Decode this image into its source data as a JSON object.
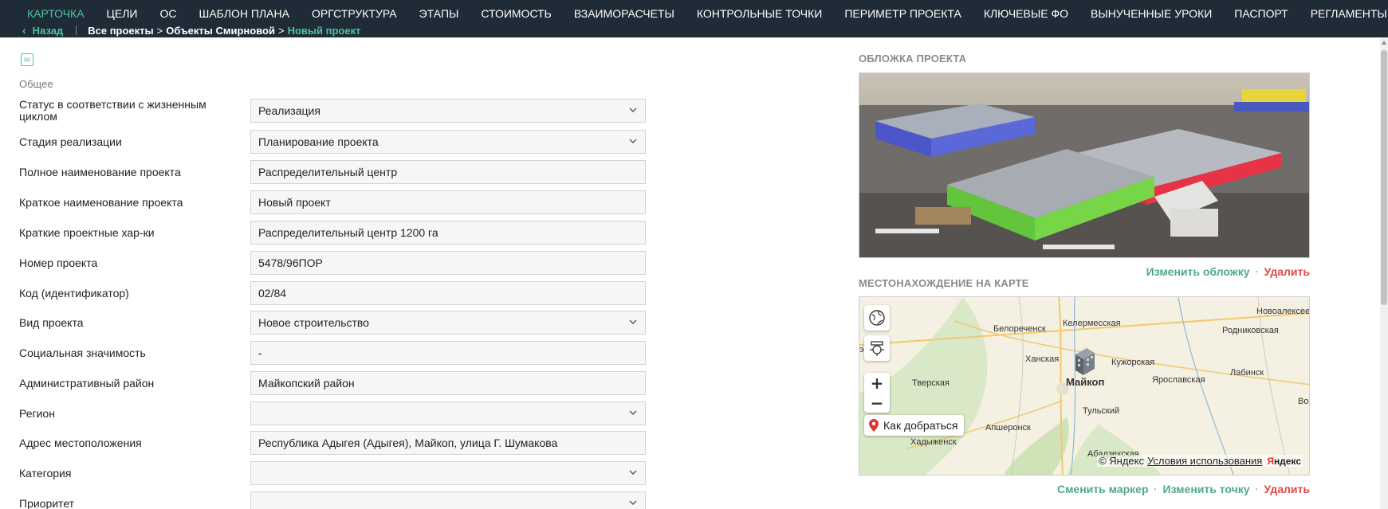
{
  "nav": {
    "items": [
      {
        "label": "Карточка",
        "active": true
      },
      {
        "label": "Цели"
      },
      {
        "label": "ОС"
      },
      {
        "label": "Шаблон плана"
      },
      {
        "label": "Оргструктура"
      },
      {
        "label": "Этапы"
      },
      {
        "label": "Стоимость"
      },
      {
        "label": "Взаиморасчеты"
      },
      {
        "label": "Контрольные точки"
      },
      {
        "label": "Периметр проекта"
      },
      {
        "label": "Ключевые ФО"
      },
      {
        "label": "Вынученные уроки"
      },
      {
        "label": "Паспорт"
      },
      {
        "label": "Регламенты"
      }
    ]
  },
  "breadcrumbs": {
    "back": "Назад",
    "items": [
      "Все проекты",
      "Объекты Смирновой"
    ],
    "current": "Новый проект",
    "separator": ">"
  },
  "form": {
    "section": "Общее",
    "fields": [
      {
        "label": "Статус в соответствии с жизненным циклом",
        "value": "Реализация",
        "type": "select"
      },
      {
        "label": "Стадия реализации",
        "value": "Планирование проекта",
        "type": "select"
      },
      {
        "label": "Полное наименование проекта",
        "value": "Распределительный центр",
        "type": "text"
      },
      {
        "label": "Краткое наименование проекта",
        "value": "Новый проект",
        "type": "text"
      },
      {
        "label": "Краткие проектные хар-ки",
        "value": "Распределительный центр 1200 га",
        "type": "text"
      },
      {
        "label": "Номер проекта",
        "value": "5478/96ПОР",
        "type": "text"
      },
      {
        "label": "Код (идентификатор)",
        "value": "02/84",
        "type": "text"
      },
      {
        "label": "Вид проекта",
        "value": "Новое строительство",
        "type": "select"
      },
      {
        "label": "Социальная значимость",
        "value": "-",
        "type": "text"
      },
      {
        "label": "Административный район",
        "value": "Майкопский район",
        "type": "text"
      },
      {
        "label": "Регион",
        "value": "",
        "type": "select"
      },
      {
        "label": "Адрес местоположения",
        "value": "Республика Адыгея (Адыгея), Майкоп, улица Г. Шумакова",
        "type": "text"
      },
      {
        "label": "Категория",
        "value": "",
        "type": "select"
      },
      {
        "label": "Приоритет",
        "value": "",
        "type": "select"
      }
    ]
  },
  "cover": {
    "title": "Обложка проекта",
    "change": "Изменить обложку",
    "delete": "Удалить"
  },
  "map": {
    "title": "Местонахождение на карте",
    "route": "Как добраться",
    "copyright": "© Яндекс",
    "terms": "Условия использования",
    "brand_a": "Я",
    "brand_b": "ндекс",
    "towns": [
      {
        "name": "Новоалексеевская"
      },
      {
        "name": "Белореченск"
      },
      {
        "name": "Келермесская"
      },
      {
        "name": "Родниковская"
      },
      {
        "name": "Ханская"
      },
      {
        "name": "Кужорская"
      },
      {
        "name": "Майкоп"
      },
      {
        "name": "Тверская"
      },
      {
        "name": "Ярославская"
      },
      {
        "name": "Лабинск"
      },
      {
        "name": "Тульский"
      },
      {
        "name": "Апшеронск"
      },
      {
        "name": "Хадыженск"
      },
      {
        "name": "Абадзехская"
      },
      {
        "name": "Воз"
      },
      {
        "name": "эс"
      }
    ],
    "change_marker": "Сменить маркер",
    "change_point": "Изменить точку",
    "delete": "Удалить"
  },
  "colors": {
    "topbar": "#1f2b37",
    "accent": "#4fc3a1",
    "action_green": "#4fa88d",
    "danger": "#e04848"
  }
}
